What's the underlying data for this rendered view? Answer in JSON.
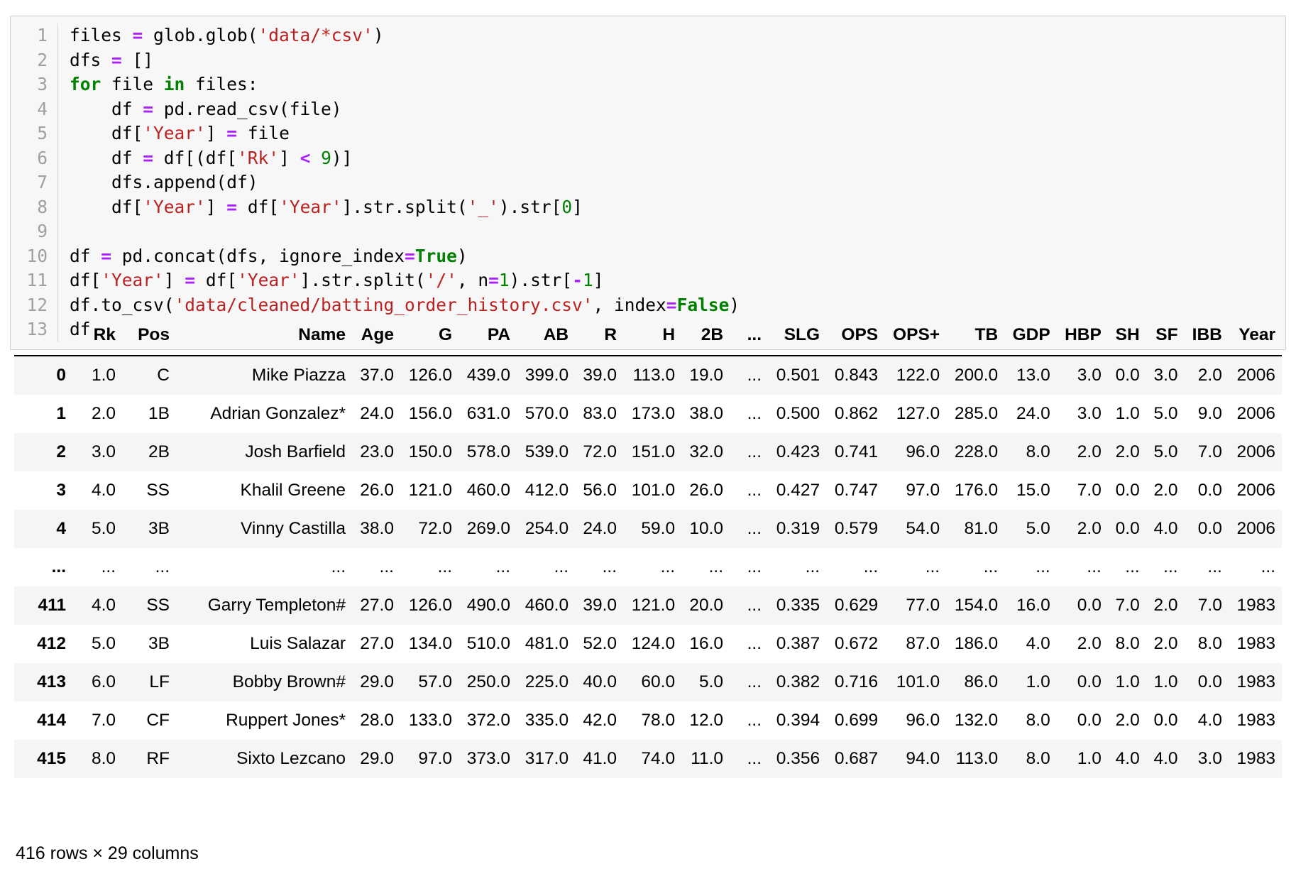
{
  "code_cell": {
    "lines": [
      {
        "n": "1",
        "tokens": [
          {
            "t": "files ",
            "c": "pl"
          },
          {
            "t": "=",
            "c": "op"
          },
          {
            "t": " glob.glob(",
            "c": "pl"
          },
          {
            "t": "'data/*csv'",
            "c": "str"
          },
          {
            "t": ")",
            "c": "pl"
          }
        ]
      },
      {
        "n": "2",
        "tokens": [
          {
            "t": "dfs ",
            "c": "pl"
          },
          {
            "t": "=",
            "c": "op"
          },
          {
            "t": " []",
            "c": "pl"
          }
        ]
      },
      {
        "n": "3",
        "tokens": [
          {
            "t": "for",
            "c": "kw"
          },
          {
            "t": " file ",
            "c": "pl"
          },
          {
            "t": "in",
            "c": "kw"
          },
          {
            "t": " files:",
            "c": "pl"
          }
        ]
      },
      {
        "n": "4",
        "tokens": [
          {
            "t": "    df ",
            "c": "pl"
          },
          {
            "t": "=",
            "c": "op"
          },
          {
            "t": " pd.read_csv(file)",
            "c": "pl"
          }
        ]
      },
      {
        "n": "5",
        "tokens": [
          {
            "t": "    df[",
            "c": "pl"
          },
          {
            "t": "'Year'",
            "c": "str"
          },
          {
            "t": "] ",
            "c": "pl"
          },
          {
            "t": "=",
            "c": "op"
          },
          {
            "t": " file",
            "c": "pl"
          }
        ]
      },
      {
        "n": "6",
        "tokens": [
          {
            "t": "    df ",
            "c": "pl"
          },
          {
            "t": "=",
            "c": "op"
          },
          {
            "t": " df[(df[",
            "c": "pl"
          },
          {
            "t": "'Rk'",
            "c": "str"
          },
          {
            "t": "] ",
            "c": "pl"
          },
          {
            "t": "<",
            "c": "op"
          },
          {
            "t": " ",
            "c": "pl"
          },
          {
            "t": "9",
            "c": "num"
          },
          {
            "t": ")]",
            "c": "pl"
          }
        ]
      },
      {
        "n": "7",
        "tokens": [
          {
            "t": "    dfs.append(df)",
            "c": "pl"
          }
        ]
      },
      {
        "n": "8",
        "tokens": [
          {
            "t": "    df[",
            "c": "pl"
          },
          {
            "t": "'Year'",
            "c": "str"
          },
          {
            "t": "] ",
            "c": "pl"
          },
          {
            "t": "=",
            "c": "op"
          },
          {
            "t": " df[",
            "c": "pl"
          },
          {
            "t": "'Year'",
            "c": "str"
          },
          {
            "t": "].str.split(",
            "c": "pl"
          },
          {
            "t": "'_'",
            "c": "str"
          },
          {
            "t": ").str[",
            "c": "pl"
          },
          {
            "t": "0",
            "c": "num"
          },
          {
            "t": "]",
            "c": "pl"
          }
        ]
      },
      {
        "n": "9",
        "tokens": [
          {
            "t": " ",
            "c": "pl"
          }
        ]
      },
      {
        "n": "10",
        "tokens": [
          {
            "t": "df ",
            "c": "pl"
          },
          {
            "t": "=",
            "c": "op"
          },
          {
            "t": " pd.concat(dfs, ignore_index",
            "c": "pl"
          },
          {
            "t": "=",
            "c": "op"
          },
          {
            "t": "True",
            "c": "bool"
          },
          {
            "t": ")",
            "c": "pl"
          }
        ]
      },
      {
        "n": "11",
        "tokens": [
          {
            "t": "df[",
            "c": "pl"
          },
          {
            "t": "'Year'",
            "c": "str"
          },
          {
            "t": "] ",
            "c": "pl"
          },
          {
            "t": "=",
            "c": "op"
          },
          {
            "t": " df[",
            "c": "pl"
          },
          {
            "t": "'Year'",
            "c": "str"
          },
          {
            "t": "].str.split(",
            "c": "pl"
          },
          {
            "t": "'/'",
            "c": "str"
          },
          {
            "t": ", n",
            "c": "pl"
          },
          {
            "t": "=",
            "c": "op"
          },
          {
            "t": "1",
            "c": "num"
          },
          {
            "t": ").str[",
            "c": "pl"
          },
          {
            "t": "-",
            "c": "op"
          },
          {
            "t": "1",
            "c": "num"
          },
          {
            "t": "]",
            "c": "pl"
          }
        ]
      },
      {
        "n": "12",
        "tokens": [
          {
            "t": "df.to_csv(",
            "c": "pl"
          },
          {
            "t": "'data/cleaned/batting_order_history.csv'",
            "c": "str"
          },
          {
            "t": ", index",
            "c": "pl"
          },
          {
            "t": "=",
            "c": "op"
          },
          {
            "t": "False",
            "c": "bool"
          },
          {
            "t": ")",
            "c": "pl"
          }
        ]
      },
      {
        "n": "13",
        "tokens": [
          {
            "t": "df",
            "c": "pl"
          }
        ]
      }
    ]
  },
  "dataframe": {
    "columns": [
      "",
      "Rk",
      "Pos",
      "Name",
      "Age",
      "G",
      "PA",
      "AB",
      "R",
      "H",
      "2B",
      "...",
      "SLG",
      "OPS",
      "OPS+",
      "TB",
      "GDP",
      "HBP",
      "SH",
      "SF",
      "IBB",
      "Year"
    ],
    "rows": [
      [
        "0",
        "1.0",
        "C",
        "Mike Piazza",
        "37.0",
        "126.0",
        "439.0",
        "399.0",
        "39.0",
        "113.0",
        "19.0",
        "...",
        "0.501",
        "0.843",
        "122.0",
        "200.0",
        "13.0",
        "3.0",
        "0.0",
        "3.0",
        "2.0",
        "2006"
      ],
      [
        "1",
        "2.0",
        "1B",
        "Adrian Gonzalez*",
        "24.0",
        "156.0",
        "631.0",
        "570.0",
        "83.0",
        "173.0",
        "38.0",
        "...",
        "0.500",
        "0.862",
        "127.0",
        "285.0",
        "24.0",
        "3.0",
        "1.0",
        "5.0",
        "9.0",
        "2006"
      ],
      [
        "2",
        "3.0",
        "2B",
        "Josh Barfield",
        "23.0",
        "150.0",
        "578.0",
        "539.0",
        "72.0",
        "151.0",
        "32.0",
        "...",
        "0.423",
        "0.741",
        "96.0",
        "228.0",
        "8.0",
        "2.0",
        "2.0",
        "5.0",
        "7.0",
        "2006"
      ],
      [
        "3",
        "4.0",
        "SS",
        "Khalil Greene",
        "26.0",
        "121.0",
        "460.0",
        "412.0",
        "56.0",
        "101.0",
        "26.0",
        "...",
        "0.427",
        "0.747",
        "97.0",
        "176.0",
        "15.0",
        "7.0",
        "0.0",
        "2.0",
        "0.0",
        "2006"
      ],
      [
        "4",
        "5.0",
        "3B",
        "Vinny Castilla",
        "38.0",
        "72.0",
        "269.0",
        "254.0",
        "24.0",
        "59.0",
        "10.0",
        "...",
        "0.319",
        "0.579",
        "54.0",
        "81.0",
        "5.0",
        "2.0",
        "0.0",
        "4.0",
        "0.0",
        "2006"
      ],
      [
        "...",
        "...",
        "...",
        "...",
        "...",
        "...",
        "...",
        "...",
        "...",
        "...",
        "...",
        "...",
        "...",
        "...",
        "...",
        "...",
        "...",
        "...",
        "...",
        "...",
        "...",
        "..."
      ],
      [
        "411",
        "4.0",
        "SS",
        "Garry Templeton#",
        "27.0",
        "126.0",
        "490.0",
        "460.0",
        "39.0",
        "121.0",
        "20.0",
        "...",
        "0.335",
        "0.629",
        "77.0",
        "154.0",
        "16.0",
        "0.0",
        "7.0",
        "2.0",
        "7.0",
        "1983"
      ],
      [
        "412",
        "5.0",
        "3B",
        "Luis Salazar",
        "27.0",
        "134.0",
        "510.0",
        "481.0",
        "52.0",
        "124.0",
        "16.0",
        "...",
        "0.387",
        "0.672",
        "87.0",
        "186.0",
        "4.0",
        "2.0",
        "8.0",
        "2.0",
        "8.0",
        "1983"
      ],
      [
        "413",
        "6.0",
        "LF",
        "Bobby Brown#",
        "29.0",
        "57.0",
        "250.0",
        "225.0",
        "40.0",
        "60.0",
        "5.0",
        "...",
        "0.382",
        "0.716",
        "101.0",
        "86.0",
        "1.0",
        "0.0",
        "1.0",
        "1.0",
        "0.0",
        "1983"
      ],
      [
        "414",
        "7.0",
        "CF",
        "Ruppert Jones*",
        "28.0",
        "133.0",
        "372.0",
        "335.0",
        "42.0",
        "78.0",
        "12.0",
        "...",
        "0.394",
        "0.699",
        "96.0",
        "132.0",
        "8.0",
        "0.0",
        "2.0",
        "0.0",
        "4.0",
        "1983"
      ],
      [
        "415",
        "8.0",
        "RF",
        "Sixto Lezcano",
        "29.0",
        "97.0",
        "373.0",
        "317.0",
        "41.0",
        "74.0",
        "11.0",
        "...",
        "0.356",
        "0.687",
        "94.0",
        "113.0",
        "8.0",
        "1.0",
        "4.0",
        "4.0",
        "3.0",
        "1983"
      ]
    ],
    "shape_caption": "416 rows × 29 columns"
  }
}
